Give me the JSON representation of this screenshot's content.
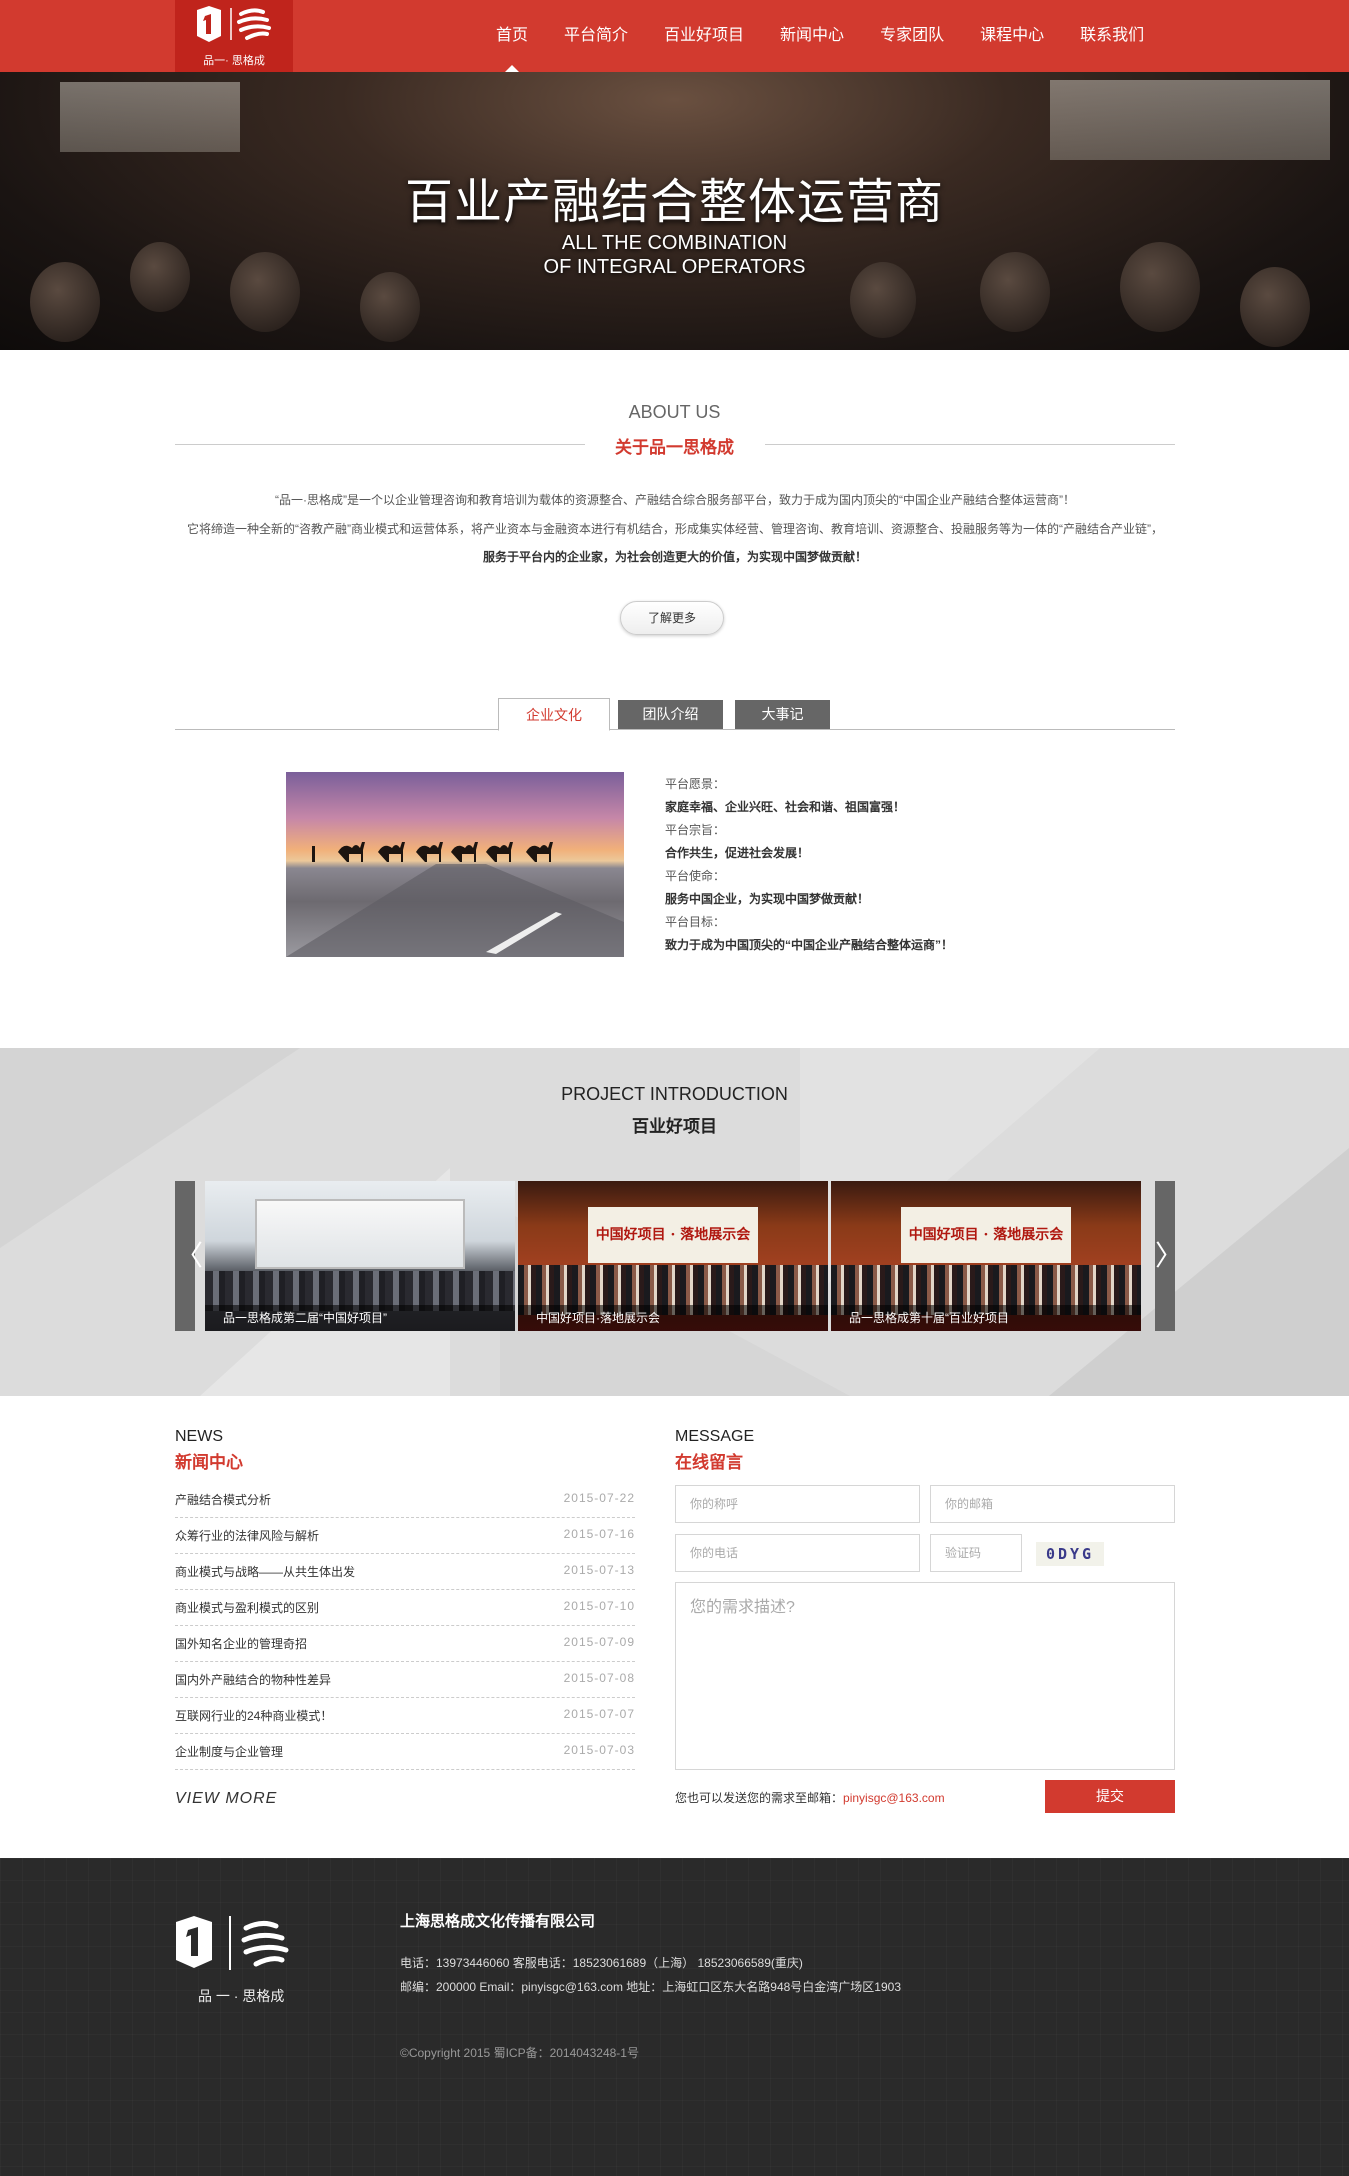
{
  "header": {
    "logo_text": "品一· 思格成",
    "nav": [
      "首页",
      "平台简介",
      "百业好项目",
      "新闻中心",
      "专家团队",
      "课程中心",
      "联系我们"
    ],
    "active_index": 0
  },
  "banner": {
    "title": "百业产融结合整体运营商",
    "subtitle_line1": "ALL THE COMBINATION",
    "subtitle_line2": "OF INTEGRAL OPERATORS"
  },
  "about": {
    "title_en": "ABOUT US",
    "title_cn": "关于品一思格成",
    "lines": [
      "“品一·思格成”是一个以企业管理咨询和教育培训为载体的资源整合、产融结合综合服务部平台，致力于成为国内顶尖的“中国企业产融结合整体运营商”！",
      "它将缔造一种全新的“咨教产融”商业模式和运营体系，将产业资本与金融资本进行有机结合，形成集实体经营、管理咨询、教育培训、资源整合、投融服务等为一体的“产融结合产业链”，",
      "服务于平台内的企业家，为社会创造更大的价值，为实现中国梦做贡献！"
    ],
    "more_button": "了解更多",
    "tabs": [
      "企业文化",
      "团队介绍",
      "大事记"
    ],
    "active_tab": 0,
    "culture": [
      {
        "label": "平台愿景：",
        "value": "家庭幸福、企业兴旺、社会和谐、祖国富强！"
      },
      {
        "label": "平台宗旨：",
        "value": "合作共生，促进社会发展！"
      },
      {
        "label": "平台使命：",
        "value": "服务中国企业，为实现中国梦做贡献！"
      },
      {
        "label": "平台目标：",
        "value": "致力于成为中国顶尖的“中国企业产融结合整体运商”！"
      }
    ]
  },
  "projects": {
    "title_en": "PROJECT INTRODUCTION",
    "title_cn": "百业好项目",
    "items": [
      {
        "caption": "品一思格成第二届“中国好项目”",
        "banner_text": ""
      },
      {
        "caption": "中国好项目·落地展示会",
        "banner_text": "中国好项目 · 落地展示会"
      },
      {
        "caption": "品一思格成第十届“百业好项目",
        "banner_text": "中国好项目 · 落地展示会"
      }
    ],
    "prev_icon": "〈",
    "next_icon": "〉"
  },
  "news": {
    "title_en": "NEWS",
    "title_cn": "新闻中心",
    "items": [
      {
        "title": "产融结合模式分析",
        "date": "2015-07-22"
      },
      {
        "title": "众筹行业的法律风险与解析",
        "date": "2015-07-16"
      },
      {
        "title": "商业模式与战略——从共生体出发",
        "date": "2015-07-13"
      },
      {
        "title": "商业模式与盈利模式的区别",
        "date": "2015-07-10"
      },
      {
        "title": "国外知名企业的管理奇招",
        "date": "2015-07-09"
      },
      {
        "title": "国内外产融结合的物种性差异",
        "date": "2015-07-08"
      },
      {
        "title": "互联网行业的24种商业模式！",
        "date": "2015-07-07"
      },
      {
        "title": "企业制度与企业管理",
        "date": "2015-07-03"
      }
    ],
    "view_more": "VIEW MORE"
  },
  "message": {
    "title_en": "MESSAGE",
    "title_cn": "在线留言",
    "name_placeholder": "你的称呼",
    "email_placeholder": "你的邮箱",
    "phone_placeholder": "你的电话",
    "code_placeholder": "验证码",
    "captcha_text": "0DYG",
    "desc_placeholder": "您的需求描述?",
    "mail_note": "您也可以发送您的需求至邮箱：",
    "mail_address": "pinyisgc@163.com",
    "submit": "提交"
  },
  "footer": {
    "logo_text": "品 一 · 思格成",
    "company": "上海思格成文化传播有限公司",
    "line1": "电话：13973446060    客服电话：18523061689（上海）  18523066589(重庆)",
    "line2": "邮编：200000   Email：pinyisgc@163.com    地址：上海虹口区东大名路948号白金湾广场区1903",
    "copyright": "©Copyright 2015 蜀ICP备：2014043248-1号"
  },
  "colors": {
    "brand_red": "#d23a2f",
    "footer_bg": "#2a2a2a"
  }
}
